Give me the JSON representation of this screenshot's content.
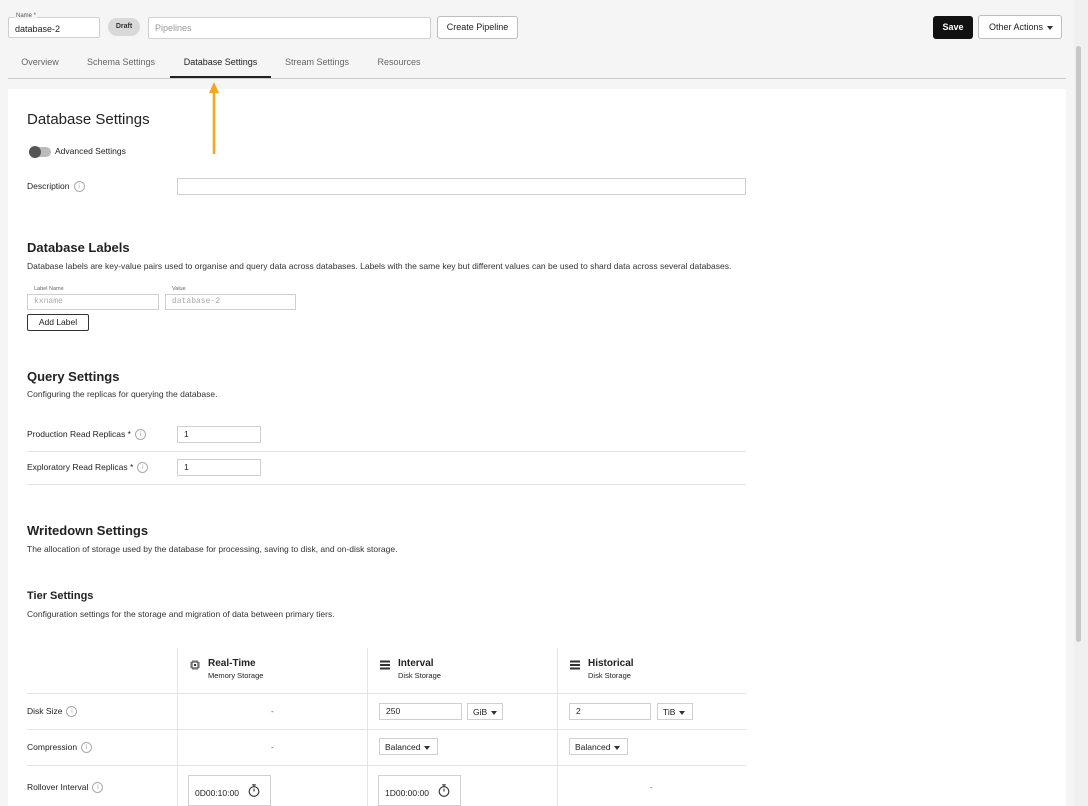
{
  "header": {
    "name_label": "Name *",
    "name_value": "database-2",
    "status_badge": "Draft",
    "pipelines_placeholder": "Pipelines",
    "create_pipeline": "Create Pipeline",
    "save": "Save",
    "other_actions": "Other Actions"
  },
  "tabs": [
    {
      "label": "Overview"
    },
    {
      "label": "Schema Settings"
    },
    {
      "label": "Database Settings",
      "active": true
    },
    {
      "label": "Stream Settings"
    },
    {
      "label": "Resources"
    }
  ],
  "database_settings": {
    "title": "Database Settings",
    "advanced_label": "Advanced Settings",
    "description_label": "Description",
    "description_value": ""
  },
  "labels": {
    "title": "Database Labels",
    "desc": "Database labels are key-value pairs used to organise and query data across databases. Labels with the same key but different values can be used to shard data across several databases.",
    "name_label": "Label Name",
    "name_placeholder": "kxname",
    "value_label": "Value",
    "value_placeholder": "database-2",
    "add_button": "Add Label"
  },
  "query": {
    "title": "Query Settings",
    "desc": "Configuring the replicas for querying the database.",
    "production_label": "Production Read Replicas *",
    "production_value": "1",
    "exploratory_label": "Exploratory Read Replicas *",
    "exploratory_value": "1"
  },
  "writedown": {
    "title": "Writedown Settings",
    "desc": "The allocation of storage used by the database for processing, saving to disk, and on-disk storage."
  },
  "tier": {
    "title": "Tier Settings",
    "desc": "Configuration settings for the storage and migration of data between primary tiers.",
    "columns": [
      {
        "title": "Real-Time",
        "subtitle": "Memory Storage",
        "icon": "chip-icon"
      },
      {
        "title": "Interval",
        "subtitle": "Disk Storage",
        "icon": "list-icon"
      },
      {
        "title": "Historical",
        "subtitle": "Disk Storage",
        "icon": "list-icon"
      }
    ],
    "rows": {
      "disk_size": {
        "label": "Disk Size",
        "realtime": "-",
        "interval_value": "250",
        "interval_unit": "GiB",
        "historical_value": "2",
        "historical_unit": "TiB"
      },
      "compression": {
        "label": "Compression",
        "realtime": "-",
        "interval": "Balanced",
        "historical": "Balanced"
      },
      "rollover": {
        "label": "Rollover Interval",
        "realtime": "0D00:10:00",
        "interval": "1D00:00:00",
        "historical": "-"
      }
    }
  },
  "colors": {
    "accent_arrow": "#f5a623",
    "save_bg": "#111111"
  }
}
